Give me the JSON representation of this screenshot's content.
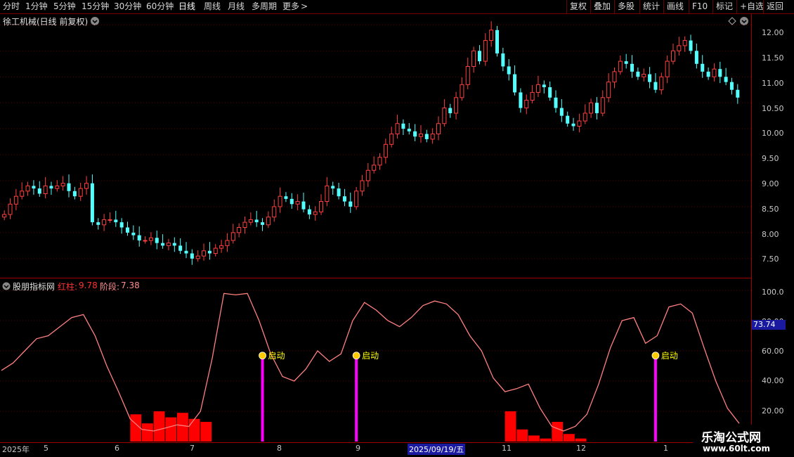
{
  "toolbar": {
    "periods": [
      "分时",
      "1分钟",
      "5分钟",
      "15分钟",
      "30分钟",
      "60分钟",
      "日线",
      "周线",
      "月线",
      "多周期",
      "更多"
    ],
    "active_period": "日线",
    "more_arrow": ">",
    "right_buttons": [
      "复权",
      "叠加",
      "多股",
      "统计",
      "画线",
      "F10",
      "标记",
      "+自选",
      "返回"
    ]
  },
  "main": {
    "title": "徐工机械(日线 前复权)",
    "price_labels": [
      "12.00",
      "11.50",
      "11.00",
      "10.50",
      "10.00",
      "9.50",
      "9.00",
      "8.50",
      "8.00",
      "7.50"
    ]
  },
  "indicator": {
    "name": "股朋指标网",
    "red_label": "红柱:",
    "red_value": "9.78",
    "stage_label": "阶段:",
    "stage_value": "7.38",
    "axis_labels": [
      "100.0",
      "80.00",
      "60.00",
      "40.00",
      "20.00"
    ],
    "current_value": "73.74",
    "signal_text": "启动",
    "colors": {
      "line": "#ff8080",
      "bars": "#ff0000",
      "signal": "#ff00ff",
      "signal_text": "#ffff00"
    }
  },
  "time_axis": {
    "labels": [
      "2025年",
      "5",
      "6",
      "7",
      "8",
      "9",
      "2025/09/19/五",
      "11",
      "12",
      "1"
    ]
  },
  "watermark": {
    "line1": "乐淘公式网",
    "line2": "www.60lt.com"
  },
  "chart_data": [
    {
      "type": "candlestick",
      "title": "徐工机械(日线 前复权)",
      "y_range": [
        7.2,
        12.1
      ],
      "close": [
        8.35,
        8.55,
        8.7,
        8.8,
        8.9,
        8.85,
        8.75,
        8.9,
        8.85,
        8.9,
        8.95,
        8.8,
        8.7,
        8.85,
        8.95,
        8.2,
        8.15,
        8.25,
        8.25,
        8.2,
        8.1,
        8.0,
        7.95,
        7.85,
        7.85,
        7.9,
        7.8,
        7.75,
        7.8,
        7.75,
        7.65,
        7.6,
        7.5,
        7.55,
        7.65,
        7.6,
        7.7,
        7.75,
        7.85,
        8.0,
        8.1,
        8.2,
        8.25,
        8.2,
        8.15,
        8.3,
        8.5,
        8.7,
        8.65,
        8.55,
        8.6,
        8.45,
        8.35,
        8.4,
        8.6,
        8.9,
        8.85,
        8.7,
        8.6,
        8.5,
        8.8,
        9.0,
        9.2,
        9.3,
        9.45,
        9.7,
        9.9,
        10.1,
        10.0,
        9.95,
        9.85,
        9.9,
        9.8,
        9.9,
        10.1,
        10.4,
        10.3,
        10.6,
        10.85,
        11.2,
        11.5,
        11.3,
        11.7,
        11.9,
        11.45,
        11.2,
        11.05,
        10.7,
        10.4,
        10.55,
        10.7,
        10.85,
        10.8,
        10.6,
        10.4,
        10.25,
        10.1,
        10.05,
        10.15,
        10.3,
        10.5,
        10.3,
        10.6,
        10.9,
        11.1,
        11.3,
        11.25,
        11.1,
        11.0,
        11.05,
        10.9,
        10.75,
        11.0,
        11.3,
        11.5,
        11.6,
        11.7,
        11.5,
        11.25,
        11.1,
        11.0,
        11.15,
        11.0,
        10.9,
        10.75,
        10.6
      ],
      "signals_at": [
        44,
        60,
        111
      ],
      "signal_label": "启动"
    },
    {
      "type": "line+bar",
      "name": "股朋指标网",
      "y_range": [
        0,
        100
      ],
      "line": [
        47,
        52,
        60,
        68,
        70,
        76,
        82,
        84,
        70,
        50,
        33,
        15,
        8,
        7,
        9,
        11,
        10,
        20,
        55,
        98,
        97,
        98,
        80,
        58,
        43,
        40,
        48,
        60,
        53,
        58,
        80,
        92,
        87,
        80,
        76,
        82,
        90,
        93,
        91,
        84,
        70,
        60,
        42,
        33,
        35,
        38,
        22,
        10,
        7,
        10,
        18,
        38,
        62,
        80,
        82,
        65,
        70,
        89,
        91,
        85,
        62,
        40,
        22,
        12
      ],
      "bars": [
        0,
        0,
        0,
        0,
        0,
        0,
        0,
        0,
        0,
        0,
        0,
        18,
        12,
        20,
        16,
        19,
        15,
        13,
        0,
        0,
        0,
        0,
        0,
        0,
        0,
        0,
        0,
        0,
        0,
        0,
        0,
        0,
        0,
        0,
        0,
        0,
        0,
        0,
        0,
        0,
        0,
        0,
        0,
        20,
        8,
        4,
        2,
        13,
        5,
        2,
        0,
        0,
        0,
        0,
        0,
        0,
        0,
        0,
        0,
        0,
        0,
        0,
        0,
        0
      ],
      "current_value": 73.74
    }
  ]
}
